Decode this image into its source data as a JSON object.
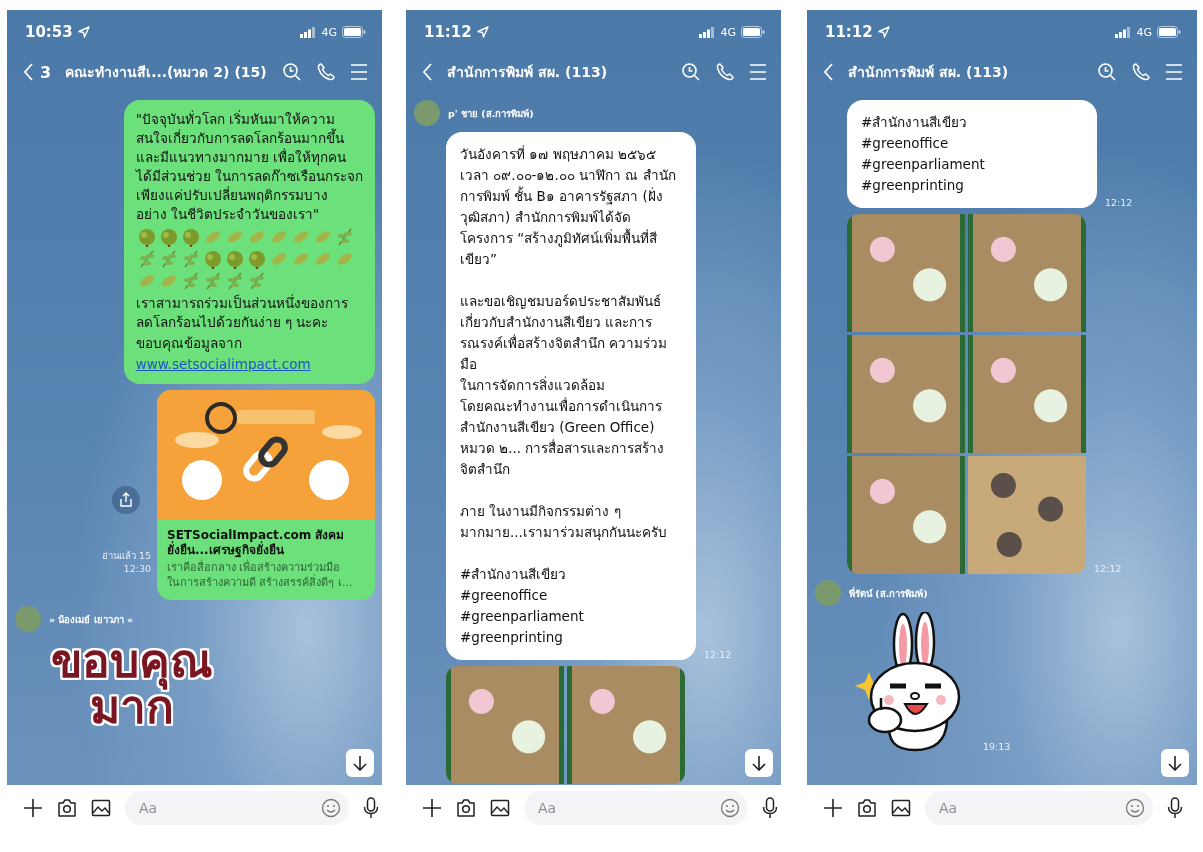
{
  "phones": [
    {
      "status_time": "10:53",
      "network": "4G",
      "header": {
        "back_count": "3",
        "title": "คณะทำงานสีเ...(หมวด 2) (15)"
      },
      "messages": [
        {
          "kind": "outgoing_text",
          "paragraphs": [
            {
              "kind": "text",
              "text": "\"ปัจจุบันทั่วโลก เริ่มหันมาให้ความ\nสนใจเกี่ยวกับการลดโลกร้อนมากขึ้น\nและมีแนวทางมากมาย เพื่อให้ทุกคน\nได้มีส่วนช่วย ในการลดก๊าซเรือนกระจก\nเพียงแค่ปรับเปลี่ยนพฤติกรรมบาง\nอย่าง ในชีวิตประจำวันของเรา\""
            },
            {
              "kind": "emoji_row"
            },
            {
              "kind": "text",
              "text": "เราสามารถร่วมเป็นส่วนหนึ่งของการ\nลดโลกร้อนไปด้วยกันง่าย ๆ นะคะ"
            },
            {
              "kind": "text",
              "text": "ขอบคุณข้อมูลจาก"
            },
            {
              "kind": "link",
              "text": "www.setsocialimpact.com"
            }
          ]
        },
        {
          "kind": "link_card",
          "title": "SETSocialImpact.com สังคม\nยั่งยืน...เศรษฐกิจยั่งยืน",
          "description": "เราคือสื่อกลาง เพื่อสร้างความร่วมมือ\nในการสร้างความดี สร้างสรรค์สิ่งดีๆ เ...",
          "read": "อ่านแล้ว 15",
          "time": "12:30"
        },
        {
          "kind": "sender",
          "name": "» น้องเมย์ เยาวภา «"
        },
        {
          "kind": "sticker_text",
          "text": "ขอบคุณ\nมาก"
        }
      ],
      "input": {
        "placeholder": "Aa"
      }
    },
    {
      "status_time": "11:12",
      "network": "4G",
      "header": {
        "title": "สำนักการพิมพ์ สผ. (113)"
      },
      "messages": [
        {
          "kind": "sender",
          "name": "p' ชาย (ส.การพิมพ์)"
        },
        {
          "kind": "incoming_text",
          "paragraphs": [
            {
              "kind": "text",
              "text": "วันอังคารที่ ๑๗ พฤษภาคม ๒๕๖๕\nเวลา ๐๙.๐๐-๑๒.๐๐ นาฬิกา ณ สำนัก\nการพิมพ์ ชั้น B๑ อาคารรัฐสภา (ฝั่ง\nวุฒิสภา) สำนักการพิมพ์ได้จัด\nโครงการ “สร้างภูมิทัศน์เพิ่มพื้นที่สี\nเขียว”"
            },
            {
              "kind": "text",
              "text": "และขอเชิญชมบอร์ดประชาสัมพันธ์\nเกี่ยวกับสำนักงานสีเขียว และการ\nรณรงค์เพื่อสร้างจิตสำนึก ความร่วมมือ\nในการจัดการสิ่งแวดล้อม\nโดยคณะทำงานเพื่อการดำเนินการ\nสำนักงานสีเขียว (Green Office)\nหมวด ๒... การสื่อสารและการสร้าง\nจิตสำนึก"
            },
            {
              "kind": "text",
              "text": "ภาย ในงานมีกิจกรรมต่าง ๆ\nมากมาย...เรามาร่วมสนุกกันนะครับ"
            },
            {
              "kind": "text",
              "text": "#สำนักงานสีเขียว\n#greenoffice\n#greenparliament\n#greenprinting"
            }
          ],
          "time": "12:12"
        },
        {
          "kind": "photo_grid",
          "photos": [
            {
              "kind": "board"
            },
            {
              "kind": "board"
            }
          ]
        }
      ],
      "input": {
        "placeholder": "Aa"
      }
    },
    {
      "status_time": "11:12",
      "network": "4G",
      "header": {
        "title": "สำนักการพิมพ์ สผ. (113)"
      },
      "messages": [
        {
          "kind": "incoming_text",
          "paragraphs": [
            {
              "kind": "text",
              "text": "#สำนักงานสีเขียว\n#greenoffice\n#greenparliament\n#greenprinting"
            }
          ],
          "time": "12:12"
        },
        {
          "kind": "photo_grid",
          "photos": [
            {
              "kind": "board"
            },
            {
              "kind": "board"
            },
            {
              "kind": "board"
            },
            {
              "kind": "board"
            },
            {
              "kind": "board"
            },
            {
              "kind": "wall"
            }
          ],
          "time": "12:12"
        },
        {
          "kind": "sender",
          "name": "พี่รัตน์ (ส.การพิมพ์)"
        },
        {
          "kind": "sticker",
          "time": "19:13"
        }
      ],
      "input": {
        "placeholder": "Aa"
      }
    }
  ]
}
